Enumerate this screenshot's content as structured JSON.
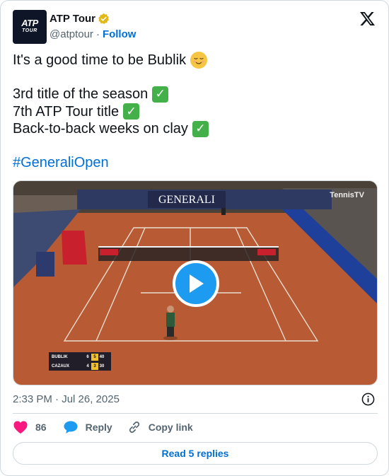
{
  "author": {
    "display_name": "ATP Tour",
    "handle": "@atptour",
    "separator": "·",
    "follow_label": "Follow",
    "avatar_logo_text": "ATP",
    "avatar_logo_subtext": "TOUR",
    "verified_badge_color": "#e2b719"
  },
  "tweet": {
    "lines": [
      "It's a good time to be Bublik",
      "3rd title of the season",
      "7th ATP Tour title",
      "Back-to-back weeks on clay",
      "#GeneraliOpen"
    ],
    "hashtag_color": "#006fd6"
  },
  "media": {
    "sponsor_banner": "GENERALI",
    "watermark": "TennisTV",
    "scoreboard": {
      "players": [
        {
          "name": "BUBLIK",
          "set1": "6",
          "set2": "5",
          "points": "40"
        },
        {
          "name": "CAZAUX",
          "set1": "4",
          "set2": "3",
          "points": "30"
        }
      ]
    },
    "play_icon": "play-icon"
  },
  "meta": {
    "timestamp": "2:33 PM · Jul 26, 2025"
  },
  "actions": {
    "likes_count": "86",
    "reply_label": "Reply",
    "copy_link_label": "Copy link",
    "like_color": "#f91880",
    "reply_icon_color": "#1d9bf0"
  },
  "footer": {
    "read_replies_label": "Read 5 replies"
  }
}
